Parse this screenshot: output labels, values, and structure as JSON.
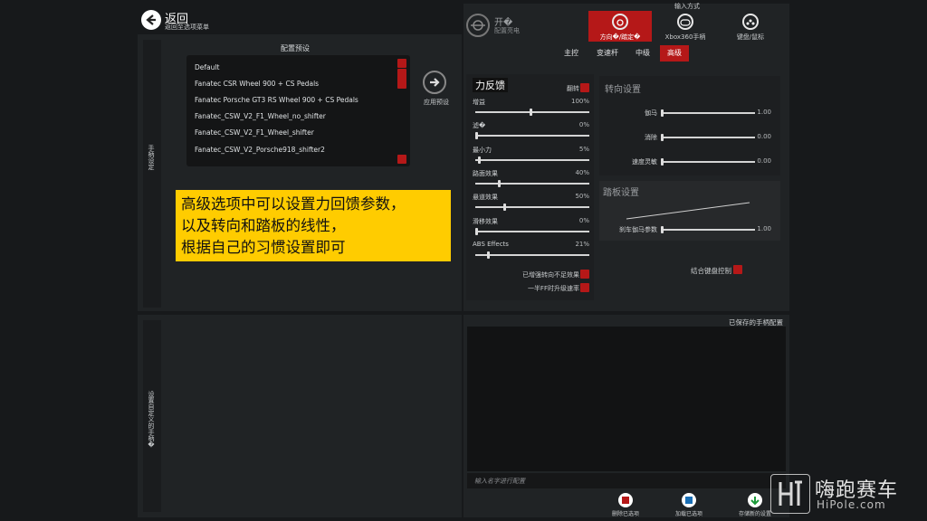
{
  "header": {
    "back_label": "返回",
    "back_sub": "返回至选项菜单"
  },
  "left_sidebar": {
    "top_label": "手柄设定",
    "bottom_label": "设置自定义的手柄�"
  },
  "presets": {
    "title": "配置预设",
    "items": [
      "Default",
      "Fanatec CSR Wheel 900 + CS Pedals",
      "Fanatec Porsche GT3 RS Wheel 900 + CS Pedals",
      "Fanatec_CSW_V2_F1_Wheel_no_shifter",
      "Fanatec_CSW_V2_F1_Wheel_shifter",
      "Fanatec_CSW_V2_Porsche918_shifter2"
    ],
    "apply_label": "应用预设"
  },
  "caption": {
    "lines": [
      "高级选项中可以设置力回馈参数，",
      "以及转向和踏板的线性，",
      "根据自己的习惯设置即可"
    ]
  },
  "input_method": {
    "title": "输入方式",
    "mode_label": "开�",
    "mode_sub": "配置亮电",
    "options": [
      {
        "label": "方向�/踏定�",
        "active": true
      },
      {
        "label": "Xbox360手柄",
        "active": false
      },
      {
        "label": "键盘/鼠标",
        "active": false
      }
    ]
  },
  "tabs": [
    "主控",
    "变速杆",
    "中级",
    "高级"
  ],
  "force_feedback": {
    "title": "力反馈",
    "invert_label": "翻转",
    "sliders": [
      {
        "label": "增益",
        "value": "100%",
        "level": 1.0
      },
      {
        "label": "滤�",
        "value": "0%",
        "level": 0.0
      },
      {
        "label": "最小力",
        "value": "5%",
        "level": 0.05
      },
      {
        "label": "路面效果",
        "value": "40%",
        "level": 0.4
      },
      {
        "label": "悬道效果",
        "value": "50%",
        "level": 0.5
      },
      {
        "label": "滑移效果",
        "value": "0%",
        "level": 0.0
      },
      {
        "label": "ABS Effects",
        "value": "21%",
        "level": 0.21
      }
    ],
    "check1": "已增强转向不足效果",
    "check2": "一半FF时升级速率"
  },
  "steering": {
    "title": "转向设置",
    "rows": [
      {
        "label": "伽马",
        "value": "1.00",
        "level": 0.0
      },
      {
        "label": "消除",
        "value": "0.00",
        "level": 0.0
      },
      {
        "label": "速度灵敏",
        "value": "0.00",
        "level": 0.0
      }
    ]
  },
  "pedals": {
    "title": "踏板设置",
    "row_label": "刹车伽马参数",
    "row_value": "1.00",
    "level": 0.0
  },
  "combine_keyboard": "结合键盘控制",
  "saved": {
    "title": "已保存的手柄配置",
    "name_placeholder": "输入名字进行配置"
  },
  "bottom_buttons": [
    "删除已选项",
    "加载已选项",
    "存储新的设置"
  ],
  "watermark": {
    "cn": "嗨跑赛车",
    "en": "HiPole.com"
  },
  "colors": {
    "accent_red": "#b51818",
    "highlight_yellow": "#ffcc00"
  }
}
